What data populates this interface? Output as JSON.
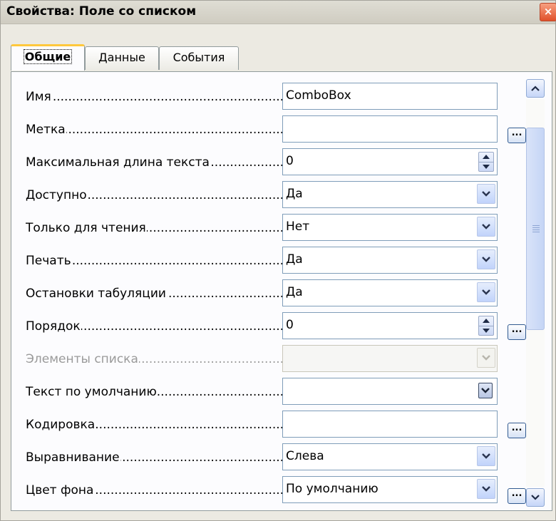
{
  "window": {
    "title": "Свойства: Поле со списком",
    "close_glyph": "×"
  },
  "tabs": [
    {
      "label": "Общие",
      "active": true
    },
    {
      "label": "Данные",
      "active": false
    },
    {
      "label": "События",
      "active": false
    }
  ],
  "rows": [
    {
      "label": "Имя",
      "value": "ComboBox",
      "control": "text",
      "browse": false
    },
    {
      "label": "Метка",
      "value": "",
      "control": "text",
      "browse": true
    },
    {
      "label": "Максимальная длина текста",
      "value": "0",
      "control": "spin",
      "browse": false
    },
    {
      "label": "Доступно",
      "value": "Да",
      "control": "dropdown",
      "browse": false
    },
    {
      "label": "Только для чтения",
      "value": "Нет",
      "control": "dropdown",
      "browse": false
    },
    {
      "label": "Печать",
      "value": "Да",
      "control": "dropdown",
      "browse": false
    },
    {
      "label": "Остановки табуляции",
      "value": "Да",
      "control": "dropdown",
      "browse": false
    },
    {
      "label": "Порядок",
      "value": "0",
      "control": "spin",
      "browse": true
    },
    {
      "label": "Элементы списка",
      "value": "",
      "control": "dropdown-disabled",
      "browse": false
    },
    {
      "label": "Текст по умолчанию",
      "value": "",
      "control": "dropdown-dark",
      "browse": false
    },
    {
      "label": "Кодировка",
      "value": "",
      "control": "text",
      "browse": true
    },
    {
      "label": "Выравнивание",
      "value": "Слева",
      "control": "dropdown",
      "browse": false
    },
    {
      "label": "Цвет фона",
      "value": "По умолчанию",
      "control": "dropdown",
      "browse": true
    }
  ],
  "browse_label": "...",
  "colors": {
    "tab_accent": "#ffc83c",
    "field_border": "#7f9db9",
    "disabled_text": "#9a9a9a"
  }
}
